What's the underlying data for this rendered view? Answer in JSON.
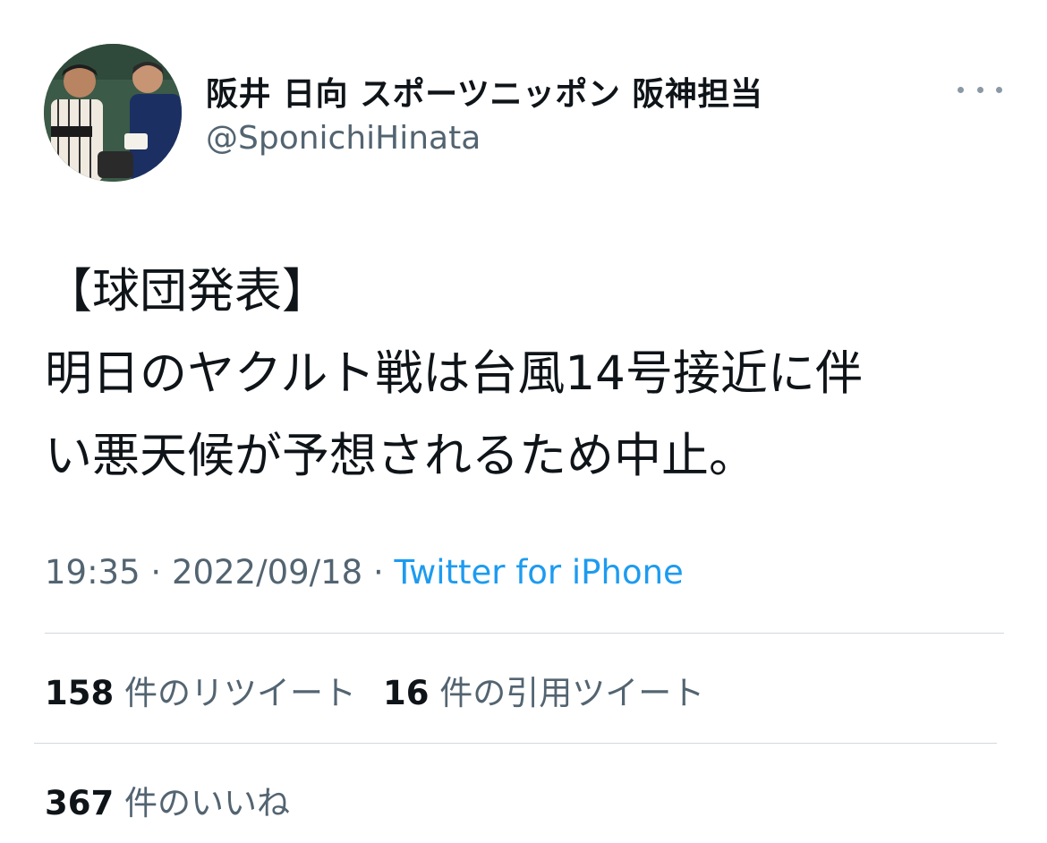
{
  "author": {
    "display_name": "阪井 日向 スポーツニッポン 阪神担当",
    "handle": "@SponichiHinata",
    "avatar_icon": "user-avatar-photo"
  },
  "more_icon": "ellipsis-icon",
  "tweet": {
    "lines": [
      "【球団発表】",
      "明日のヤクルト戦は台風14号接近に伴",
      "い悪天候が予想されるため中止。"
    ]
  },
  "meta": {
    "time": "19:35",
    "separator": "·",
    "date": "2022/09/18",
    "source": "Twitter for iPhone"
  },
  "stats": {
    "retweets": {
      "count": "158",
      "label": "件のリツイート"
    },
    "quotes": {
      "count": "16",
      "label": "件の引用ツイート"
    },
    "likes": {
      "count": "367",
      "label": "件のいいね"
    }
  },
  "colors": {
    "text": "#0f1419",
    "secondary": "#536471",
    "link": "#1d9bf0",
    "divider": "#cfd9de"
  }
}
